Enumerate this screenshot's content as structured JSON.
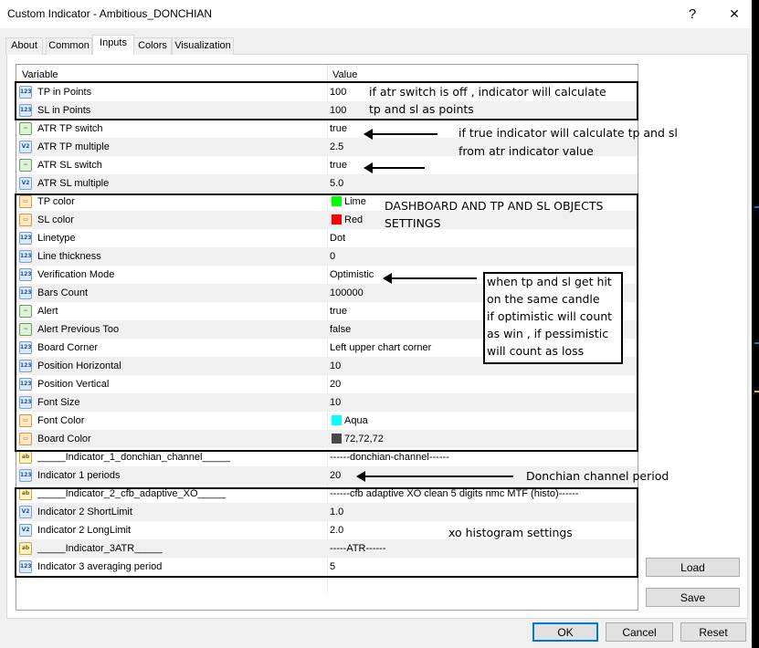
{
  "window": {
    "title": "Custom Indicator - Ambitious_DONCHIAN",
    "help_glyph": "?",
    "close_glyph": "✕"
  },
  "tabs": [
    {
      "label": "About"
    },
    {
      "label": "Common"
    },
    {
      "label": "Inputs",
      "active": true
    },
    {
      "label": "Colors"
    },
    {
      "label": "Visualization"
    }
  ],
  "table": {
    "headers": {
      "variable": "Variable",
      "value": "Value"
    },
    "rows": [
      {
        "name": "TP in Points",
        "value": "100",
        "icon": "number-icon"
      },
      {
        "name": "SL in Points",
        "value": "100",
        "icon": "number-icon"
      },
      {
        "name": "ATR TP switch",
        "value": "true",
        "icon": "toggle-icon"
      },
      {
        "name": "ATR TP multiple",
        "value": "2.5",
        "icon": "decimal-icon"
      },
      {
        "name": "ATR SL switch",
        "value": "true",
        "icon": "toggle-icon"
      },
      {
        "name": "ATR SL multiple",
        "value": "5.0",
        "icon": "decimal-icon"
      },
      {
        "name": "TP color",
        "value": "Lime",
        "icon": "color-icon",
        "swatch": "#00ff00"
      },
      {
        "name": "SL color",
        "value": "Red",
        "icon": "color-icon",
        "swatch": "#ff0000"
      },
      {
        "name": "Linetype",
        "value": "Dot",
        "icon": "number-icon"
      },
      {
        "name": "Line thickness",
        "value": "0",
        "icon": "number-icon"
      },
      {
        "name": "Verification Mode",
        "value": "Optimistic",
        "icon": "number-icon"
      },
      {
        "name": "Bars Count",
        "value": "100000",
        "icon": "number-icon"
      },
      {
        "name": "Alert",
        "value": "true",
        "icon": "toggle-icon"
      },
      {
        "name": "Alert Previous Too",
        "value": "false",
        "icon": "toggle-icon"
      },
      {
        "name": "Board Corner",
        "value": "Left upper chart corner",
        "icon": "number-icon"
      },
      {
        "name": "Position Horizontal",
        "value": "10",
        "icon": "number-icon"
      },
      {
        "name": "Position Vertical",
        "value": "20",
        "icon": "number-icon"
      },
      {
        "name": "Font Size",
        "value": "10",
        "icon": "number-icon"
      },
      {
        "name": "Font Color",
        "value": "Aqua",
        "icon": "color-icon",
        "swatch": "#00ffff"
      },
      {
        "name": "Board Color",
        "value": "72,72,72",
        "icon": "color-icon",
        "swatch": "#484848"
      },
      {
        "name": "_____Indicator_1_donchian_channel_____",
        "value": "------donchian-channel------",
        "icon": "string-icon"
      },
      {
        "name": "Indicator 1 periods",
        "value": "20",
        "icon": "number-icon"
      },
      {
        "name": "_____Indicator_2_cfb_adaptive_XO_____",
        "value": "------cfb adaptive XO clean 5 digits nmc MTF (histo)------",
        "icon": "string-icon"
      },
      {
        "name": "Indicator 2 ShortLimit",
        "value": "1.0",
        "icon": "decimal-icon"
      },
      {
        "name": "Indicator 2 LongLimit",
        "value": "2.0",
        "icon": "decimal-icon"
      },
      {
        "name": "_____Indicator_3ATR_____",
        "value": "-----ATR------",
        "icon": "string-icon"
      },
      {
        "name": "Indicator 3 averaging period",
        "value": "5",
        "icon": "number-icon"
      }
    ]
  },
  "buttons": {
    "load": "Load",
    "save": "Save",
    "ok": "OK",
    "cancel": "Cancel",
    "reset": "Reset"
  },
  "icon_glyphs": {
    "number": "123",
    "decimal": "V2",
    "toggle": "~",
    "color": "▭",
    "string": "ab"
  },
  "annotations": {
    "points_note": [
      "if atr switch is off , indicator will calculate",
      "tp and sl as points"
    ],
    "atr_note": [
      "if true indicator will calculate tp and sl",
      "from atr indicator value"
    ],
    "dashboard_note": [
      "DASHBOARD AND TP AND SL OBJECTS",
      "SETTINGS"
    ],
    "verification_note": [
      "when tp and sl get hit",
      "on the same candle",
      "if optimistic will count",
      "as win , if pessimistic",
      "will count as loss"
    ],
    "donchian_note": "Donchian channel period",
    "xo_note": "xo histogram settings"
  }
}
